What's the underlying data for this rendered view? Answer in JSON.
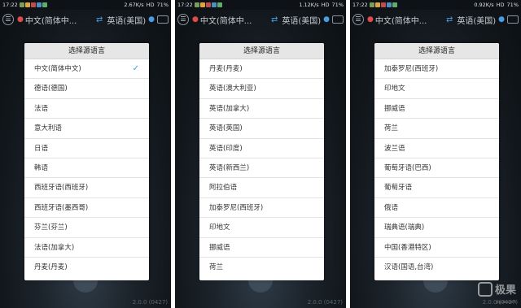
{
  "panels": [
    {
      "status": {
        "time": "17:22",
        "speed": "2.67K/s",
        "net": "HD",
        "battery": "71%"
      },
      "toolbar": {
        "source": "中文(简体中...",
        "target": "英语(美国)"
      },
      "dialog": {
        "title": "选择源语言",
        "items": [
          "中文(简体中文)",
          "德语(德国)",
          "法语",
          "意大利语",
          "日语",
          "韩语",
          "西班牙语(西班牙)",
          "西班牙语(墨西哥)",
          "芬兰(芬兰)",
          "法语(加拿大)",
          "丹麦(丹麦)"
        ],
        "selected_index": 0
      },
      "version": "2.0.0 (0427)"
    },
    {
      "status": {
        "time": "17:22",
        "speed": "1.12K/s",
        "net": "HD",
        "battery": "71%"
      },
      "toolbar": {
        "source": "中文(简体中...",
        "target": "英语(美国)"
      },
      "dialog": {
        "title": "选择源语言",
        "items": [
          "丹麦(丹麦)",
          "英语(澳大利亚)",
          "英语(加拿大)",
          "英语(英国)",
          "英语(印度)",
          "英语(新西兰)",
          "阿拉伯语",
          "加泰罗尼(西班牙)",
          "印地文",
          "挪威语",
          "荷兰"
        ]
      },
      "version": "2.0.0 (0427)"
    },
    {
      "status": {
        "time": "17:22",
        "speed": "0.92K/s",
        "net": "HD",
        "battery": "71%"
      },
      "toolbar": {
        "source": "中文(简体中...",
        "target": "英语(美国)"
      },
      "dialog": {
        "title": "选择源语言",
        "items": [
          "加泰罗尼(西班牙)",
          "印地文",
          "挪威语",
          "荷兰",
          "波兰语",
          "葡萄牙语(巴西)",
          "葡萄牙语",
          "俄语",
          "瑞典语(瑞典)",
          "中国(香港特区)",
          "汉语(国语,台湾)"
        ]
      },
      "version": "2.0.0 (0427)"
    }
  ],
  "watermark": {
    "brand": "极果",
    "sub": "jiguo.com"
  },
  "icons": {
    "menu": "menu-icon",
    "mic": "mic-icon",
    "swap": "swap-icon",
    "keyboard": "keyboard-icon",
    "check": "check-icon"
  },
  "colors": {
    "accent": "#3c9ee0",
    "mic_red": "#e04c4c"
  }
}
